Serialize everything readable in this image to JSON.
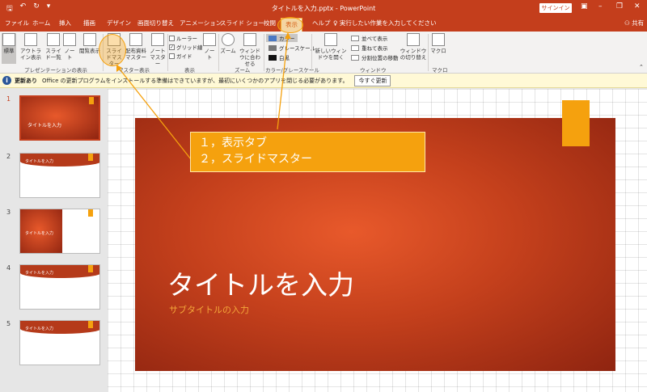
{
  "window": {
    "title": "タイトルを入力.pptx - PowerPoint",
    "signin": "サインイン",
    "qat_icons": [
      "save-icon",
      "undo-icon",
      "redo-icon",
      "customize-icon"
    ]
  },
  "tabs": [
    "ファイル",
    "ホーム",
    "挿入",
    "描画",
    "デザイン",
    "画面切り替え",
    "アニメーション",
    "スライド ショー",
    "校閲",
    "表示",
    "ヘルプ"
  ],
  "active_tab": "表示",
  "tellme": "実行したい作業を入力してください",
  "share": "共有",
  "ribbon": {
    "presentation_views": {
      "label": "プレゼンテーションの表示",
      "buttons": [
        "標準",
        "アウトライン表示",
        "スライド一覧",
        "ノート",
        "閲覧表示"
      ]
    },
    "master_views": {
      "label": "マスター表示",
      "buttons": [
        "スライドマスター",
        "配布資料マスター",
        "ノートマスター"
      ]
    },
    "show": {
      "label": "表示",
      "checks": [
        {
          "label": "ルーラー",
          "checked": false
        },
        {
          "label": "グリッド線",
          "checked": true
        },
        {
          "label": "ガイド",
          "checked": false
        }
      ],
      "note_btn": "ノート"
    },
    "zoom": {
      "label": "ズーム",
      "buttons": [
        "ズーム",
        "ウィンドウに合わせる"
      ]
    },
    "color": {
      "label": "カラー/グレースケール",
      "items": [
        "カラー",
        "グレースケール",
        "白黒"
      ]
    },
    "window": {
      "label": "ウィンドウ",
      "new_window": "新しいウィンドウを開く",
      "items": [
        "並べて表示",
        "重ねて表示",
        "分割位置の移動"
      ],
      "switch": "ウィンドウの切り替え"
    },
    "macro": {
      "label": "マクロ",
      "button": "マクロ"
    }
  },
  "message_bar": {
    "title": "更新あり",
    "text": "Office の更新プログラムをインストールする準備はできていますが、最初にいくつかのアプリを閉じる必要があります。",
    "button": "今すぐ更新"
  },
  "thumbnails": [
    {
      "num": "1",
      "title": "タイトルを入力"
    },
    {
      "num": "2",
      "title": "タイトルを入力"
    },
    {
      "num": "3",
      "title": "タイトルを入力"
    },
    {
      "num": "4",
      "title": "タイトルを入力"
    },
    {
      "num": "5",
      "title": "タイトルを入力"
    }
  ],
  "slide": {
    "title": "タイトルを入力",
    "subtitle": "サブタイトルの入力"
  },
  "callout": {
    "line1": "１，表示タブ",
    "line2": "２，スライドマスター"
  },
  "colors": {
    "accent": "#c43e1c",
    "highlight": "#f5a10e"
  }
}
